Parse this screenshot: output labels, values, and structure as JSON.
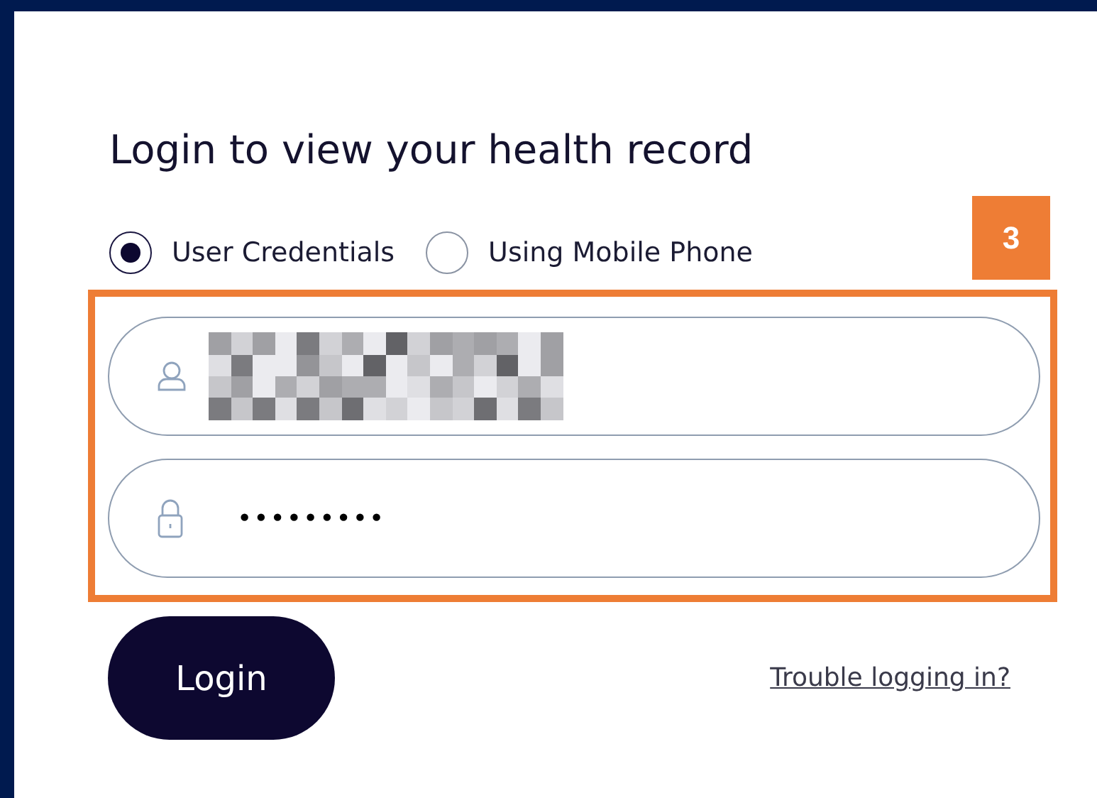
{
  "title": "Login to view your health record",
  "login_method": [
    {
      "label": "User Credentials",
      "selected": true
    },
    {
      "label": "Using Mobile Phone",
      "selected": false
    }
  ],
  "annotation": {
    "label": "3"
  },
  "fields": [
    {
      "kind": "username",
      "redacted": true
    },
    {
      "kind": "password",
      "value": "•••••••••"
    }
  ],
  "login_button": "Login",
  "help_link": "Trouble logging in?"
}
